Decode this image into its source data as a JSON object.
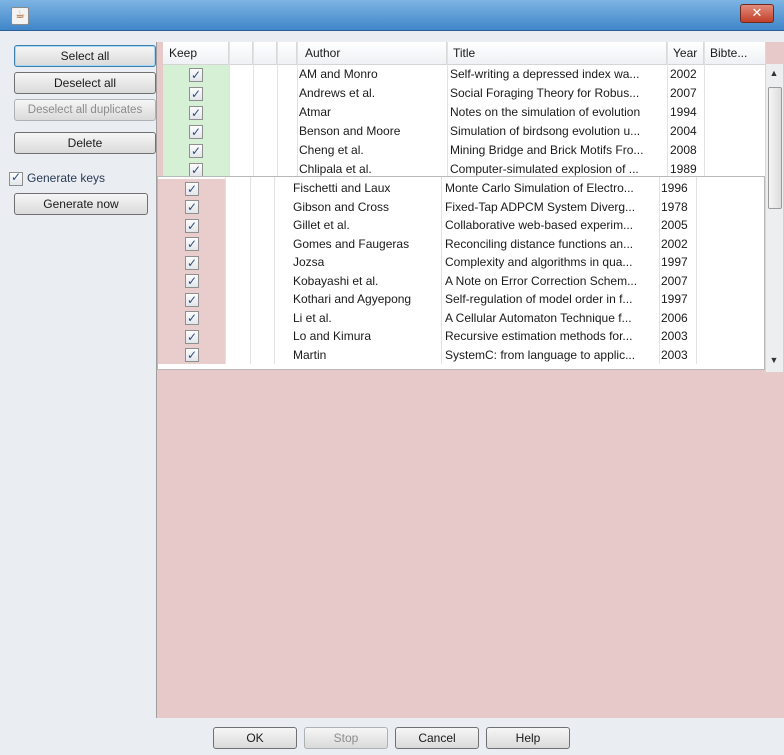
{
  "window": {
    "close_label": "✕"
  },
  "left": {
    "select_all": "Select all",
    "deselect_all": "Deselect all",
    "deselect_all_duplicates": "Deselect all duplicates",
    "delete": "Delete",
    "generate_keys": "Generate keys",
    "generate_now": "Generate now"
  },
  "table": {
    "columns": [
      "Keep",
      "",
      "",
      "Author",
      "Title",
      "Year",
      "Bibte..."
    ],
    "top_rows": [
      {
        "author": "AM and Monro",
        "title": "Self-writing a depressed index wa...",
        "year": "2002"
      },
      {
        "author": "Andrews et al.",
        "title": "Social Foraging Theory for Robus...",
        "year": "2007"
      },
      {
        "author": "Atmar",
        "title": "Notes on the simulation of evolution",
        "year": "1994"
      },
      {
        "author": "Benson and Moore",
        "title": "Simulation of birdsong evolution u...",
        "year": "2004"
      },
      {
        "author": "Cheng et al.",
        "title": "Mining Bridge and Brick Motifs Fro...",
        "year": "2008"
      },
      {
        "author": "Chlipala et al.",
        "title": "Computer-simulated explosion of ...",
        "year": "1989"
      }
    ],
    "bottom_rows": [
      {
        "author": "Fischetti and Laux",
        "title": "Monte Carlo Simulation of Electro...",
        "year": "1996"
      },
      {
        "author": "Gibson and Cross",
        "title": "Fixed-Tap ADPCM System Diverg...",
        "year": "1978"
      },
      {
        "author": "Gillet et al.",
        "title": "Collaborative web-based experim...",
        "year": "2005"
      },
      {
        "author": "Gomes and Faugeras",
        "title": "Reconciling distance functions an...",
        "year": "2002"
      },
      {
        "author": "Jozsa",
        "title": "Complexity and algorithms in qua...",
        "year": "1997"
      },
      {
        "author": "Kobayashi et al.",
        "title": "A Note on Error Correction Schem...",
        "year": "2007"
      },
      {
        "author": "Kothari and Agyepong",
        "title": "Self-regulation of model order in f...",
        "year": "1997"
      },
      {
        "author": "Li et al.",
        "title": "A Cellular Automaton Technique f...",
        "year": "2006"
      },
      {
        "author": "Lo and Kimura",
        "title": "Recursive estimation methods for...",
        "year": "2003"
      },
      {
        "author": "Martin",
        "title": "SystemC: from language to applic...",
        "year": "2003"
      }
    ]
  },
  "footer": {
    "ok": "OK",
    "stop": "Stop",
    "cancel": "Cancel",
    "help": "Help"
  },
  "colors": {
    "keep_green": "#d6f0d6",
    "keep_red": "#e9cccc",
    "background_red": "#e7c9c9"
  }
}
